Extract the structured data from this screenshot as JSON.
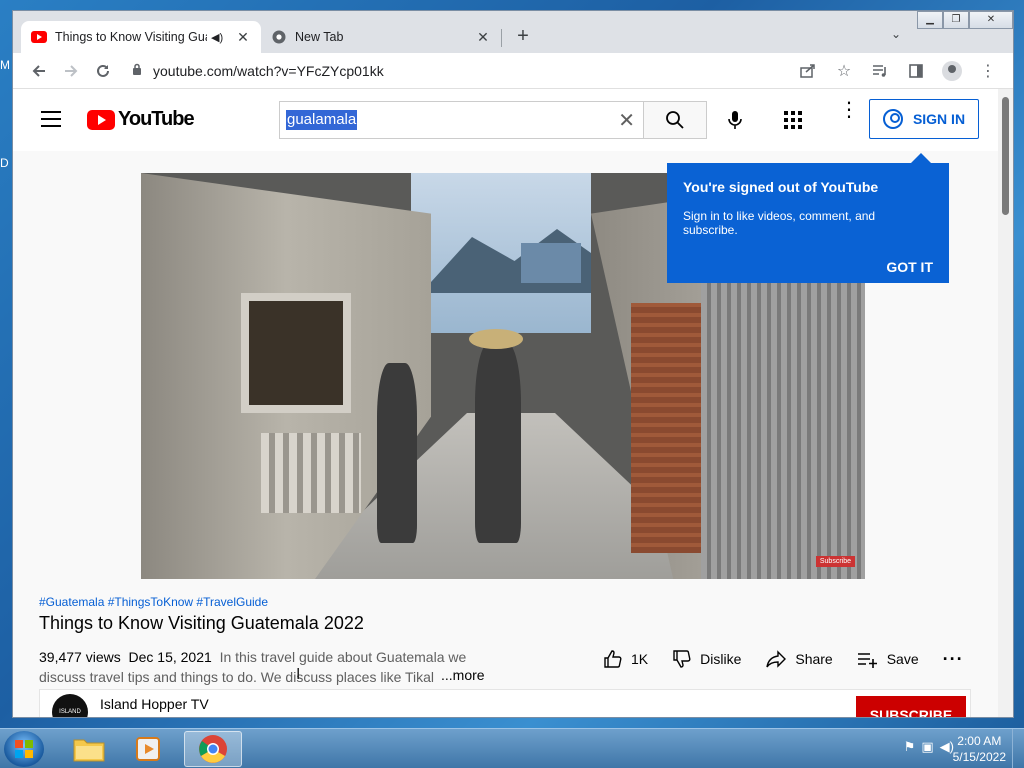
{
  "desktop": {
    "edge_letters": [
      "M",
      "D"
    ]
  },
  "browser": {
    "tabs": [
      {
        "title": "Things to Know Visiting Gua",
        "active": true,
        "audio": true
      },
      {
        "title": "New Tab",
        "active": false
      }
    ],
    "address": "youtube.com/watch?v=YFcZYcp01kk"
  },
  "youtube": {
    "logo_text": "YouTube",
    "search_query": "gualamala",
    "sign_in_label": "SIGN IN",
    "tooltip": {
      "title": "You're signed out of YouTube",
      "body": "Sign in to like videos, comment, and subscribe.",
      "action": "GOT IT"
    },
    "video": {
      "hashtags": "#Guatemala #ThingsToKnow #TravelGuide",
      "title": "Things to Know Visiting Guatemala 2022",
      "views": "39,477 views",
      "date": "Dec 15, 2021",
      "description": "In this travel guide about Guatemala we discuss travel tips and things to do. We discuss places like Tikal",
      "more_label": "...more",
      "subscribe_watermark": "Subscribe"
    },
    "actions": {
      "likes": "1K",
      "dislike": "Dislike",
      "share": "Share",
      "save": "Save"
    },
    "channel": {
      "name": "Island Hopper TV",
      "avatar_text": "ISLAND HOPPER",
      "subscribe_label": "SUBSCRIBE"
    }
  },
  "taskbar": {
    "time": "2:00 AM",
    "date": "5/15/2022"
  },
  "colors": {
    "yt_red": "#ff0000",
    "yt_blue": "#065fd4",
    "tooltip_blue": "#0a62d4"
  }
}
